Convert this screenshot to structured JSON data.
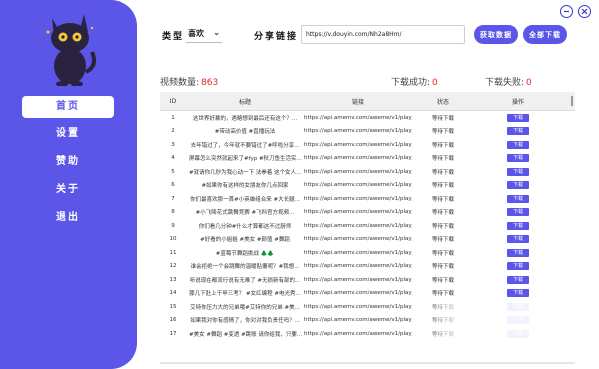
{
  "sidebar": {
    "items": [
      {
        "label": "首页",
        "active": true
      },
      {
        "label": "设置",
        "active": false
      },
      {
        "label": "赞助",
        "active": false
      },
      {
        "label": "关于",
        "active": false
      },
      {
        "label": "退出",
        "active": false
      }
    ],
    "accent": "#5b55e8"
  },
  "toolbar": {
    "type_label": "类型",
    "type_value": "喜欢",
    "share_label": "分享链接",
    "url_value": "https://v.douyin.com/Nh2a8Hm/",
    "fetch_label": "获取数据",
    "download_all_label": "全部下载"
  },
  "stats": {
    "count_label": "视频数量:",
    "count_value": "863",
    "success_label": "下载成功:",
    "success_value": "0",
    "fail_label": "下载失败:",
    "fail_value": "0"
  },
  "table": {
    "headers": [
      "ID",
      "标题",
      "链接",
      "状态",
      "操作"
    ],
    "rows": [
      {
        "id": "1",
        "title": "这世界好暴的，遇略想到最后还有这个？...",
        "link": "https://api.amemv.com/aweme/v1/play/...",
        "status": "等待下载",
        "op": "下载"
      },
      {
        "id": "2",
        "title": "#带动高价值 #直播玩法",
        "link": "https://api.amemv.com/aweme/v1/play/...",
        "status": "等待下载",
        "op": "下载"
      },
      {
        "id": "3",
        "title": "去年错过了，今年就不要错过了#呼啦分享...",
        "link": "https://api.amemv.com/aweme/v1/play/...",
        "status": "等待下载",
        "op": "下载"
      },
      {
        "id": "4",
        "title": "屏幕怎么突然就起来了#fyp #秋刀鱼生活实...",
        "link": "https://api.amemv.com/aweme/v1/play/...",
        "status": "等待下载",
        "op": "下载"
      },
      {
        "id": "5",
        "title": "#就请你几秒为我心动一下 法拳着 这个女人...",
        "link": "https://api.amemv.com/aweme/v1/play/...",
        "status": "等待下载",
        "op": "下载"
      },
      {
        "id": "6",
        "title": "#如果你有这样的女朋友你几点回家",
        "link": "https://api.amemv.com/aweme/v1/play/...",
        "status": "等待下载",
        "op": "下载"
      },
      {
        "id": "7",
        "title": "你们最喜欢那一首#小英雄组合来 #大长腿...",
        "link": "https://api.amemv.com/aweme/v1/play/...",
        "status": "等待下载",
        "op": "下载"
      },
      {
        "id": "8",
        "title": "#小飞降花式跳舞竞赛 #飞科官方视频...",
        "link": "https://api.amemv.com/aweme/v1/play/...",
        "status": "等待下载",
        "op": "下载"
      },
      {
        "id": "9",
        "title": "你们看几分钟#什么才算都这不过厨师",
        "link": "https://api.amemv.com/aweme/v1/play/...",
        "status": "等待下载",
        "op": "下载"
      },
      {
        "id": "10",
        "title": "#好看的小姐姐 #美女 #颜值 #舞蹈",
        "link": "https://api.amemv.com/aweme/v1/play/...",
        "status": "等待下载",
        "op": "下载"
      },
      {
        "id": "11",
        "title": "#蓝莓节舞蹈挑战 🌲🌲",
        "link": "https://api.amemv.com/aweme/v1/play/...",
        "status": "等待下载",
        "op": "下载"
      },
      {
        "id": "12",
        "title": "谁会拒绝一个会跳舞的温暖贴覆呢？#我想...",
        "link": "https://api.amemv.com/aweme/v1/play/...",
        "status": "等待下载",
        "op": "下载"
      },
      {
        "id": "13",
        "title": "听说现在都流行说有无难了 #无损新有部的...",
        "link": "https://api.amemv.com/aweme/v1/play/...",
        "status": "等待下载",
        "op": "下载"
      },
      {
        "id": "14",
        "title": "膝几下肚上干甲三考？ #女红编程 #电光秀...",
        "link": "https://api.amemv.com/aweme/v1/play/...",
        "status": "等待下载",
        "op": "下载"
      },
      {
        "id": "15",
        "title": "艾特你压力大的兄弟哦#艾特你的兄弟 #美...",
        "link": "https://api.amemv.com/aweme/v1/play/...",
        "status": "等待下载",
        "op": "下载"
      },
      {
        "id": "16",
        "title": "如果我对你有感情了，你对对我负责任吗？...",
        "link": "https://api.amemv.com/aweme/v1/play/...",
        "status": "等待下载",
        "op": "下载"
      },
      {
        "id": "17",
        "title": "#美女 #舞蹈 #变透 #跳账 请你给我，只要...",
        "link": "https://api.amemv.com/aweme/v1/play/...",
        "status": "等待下载",
        "op": "下载"
      }
    ]
  }
}
